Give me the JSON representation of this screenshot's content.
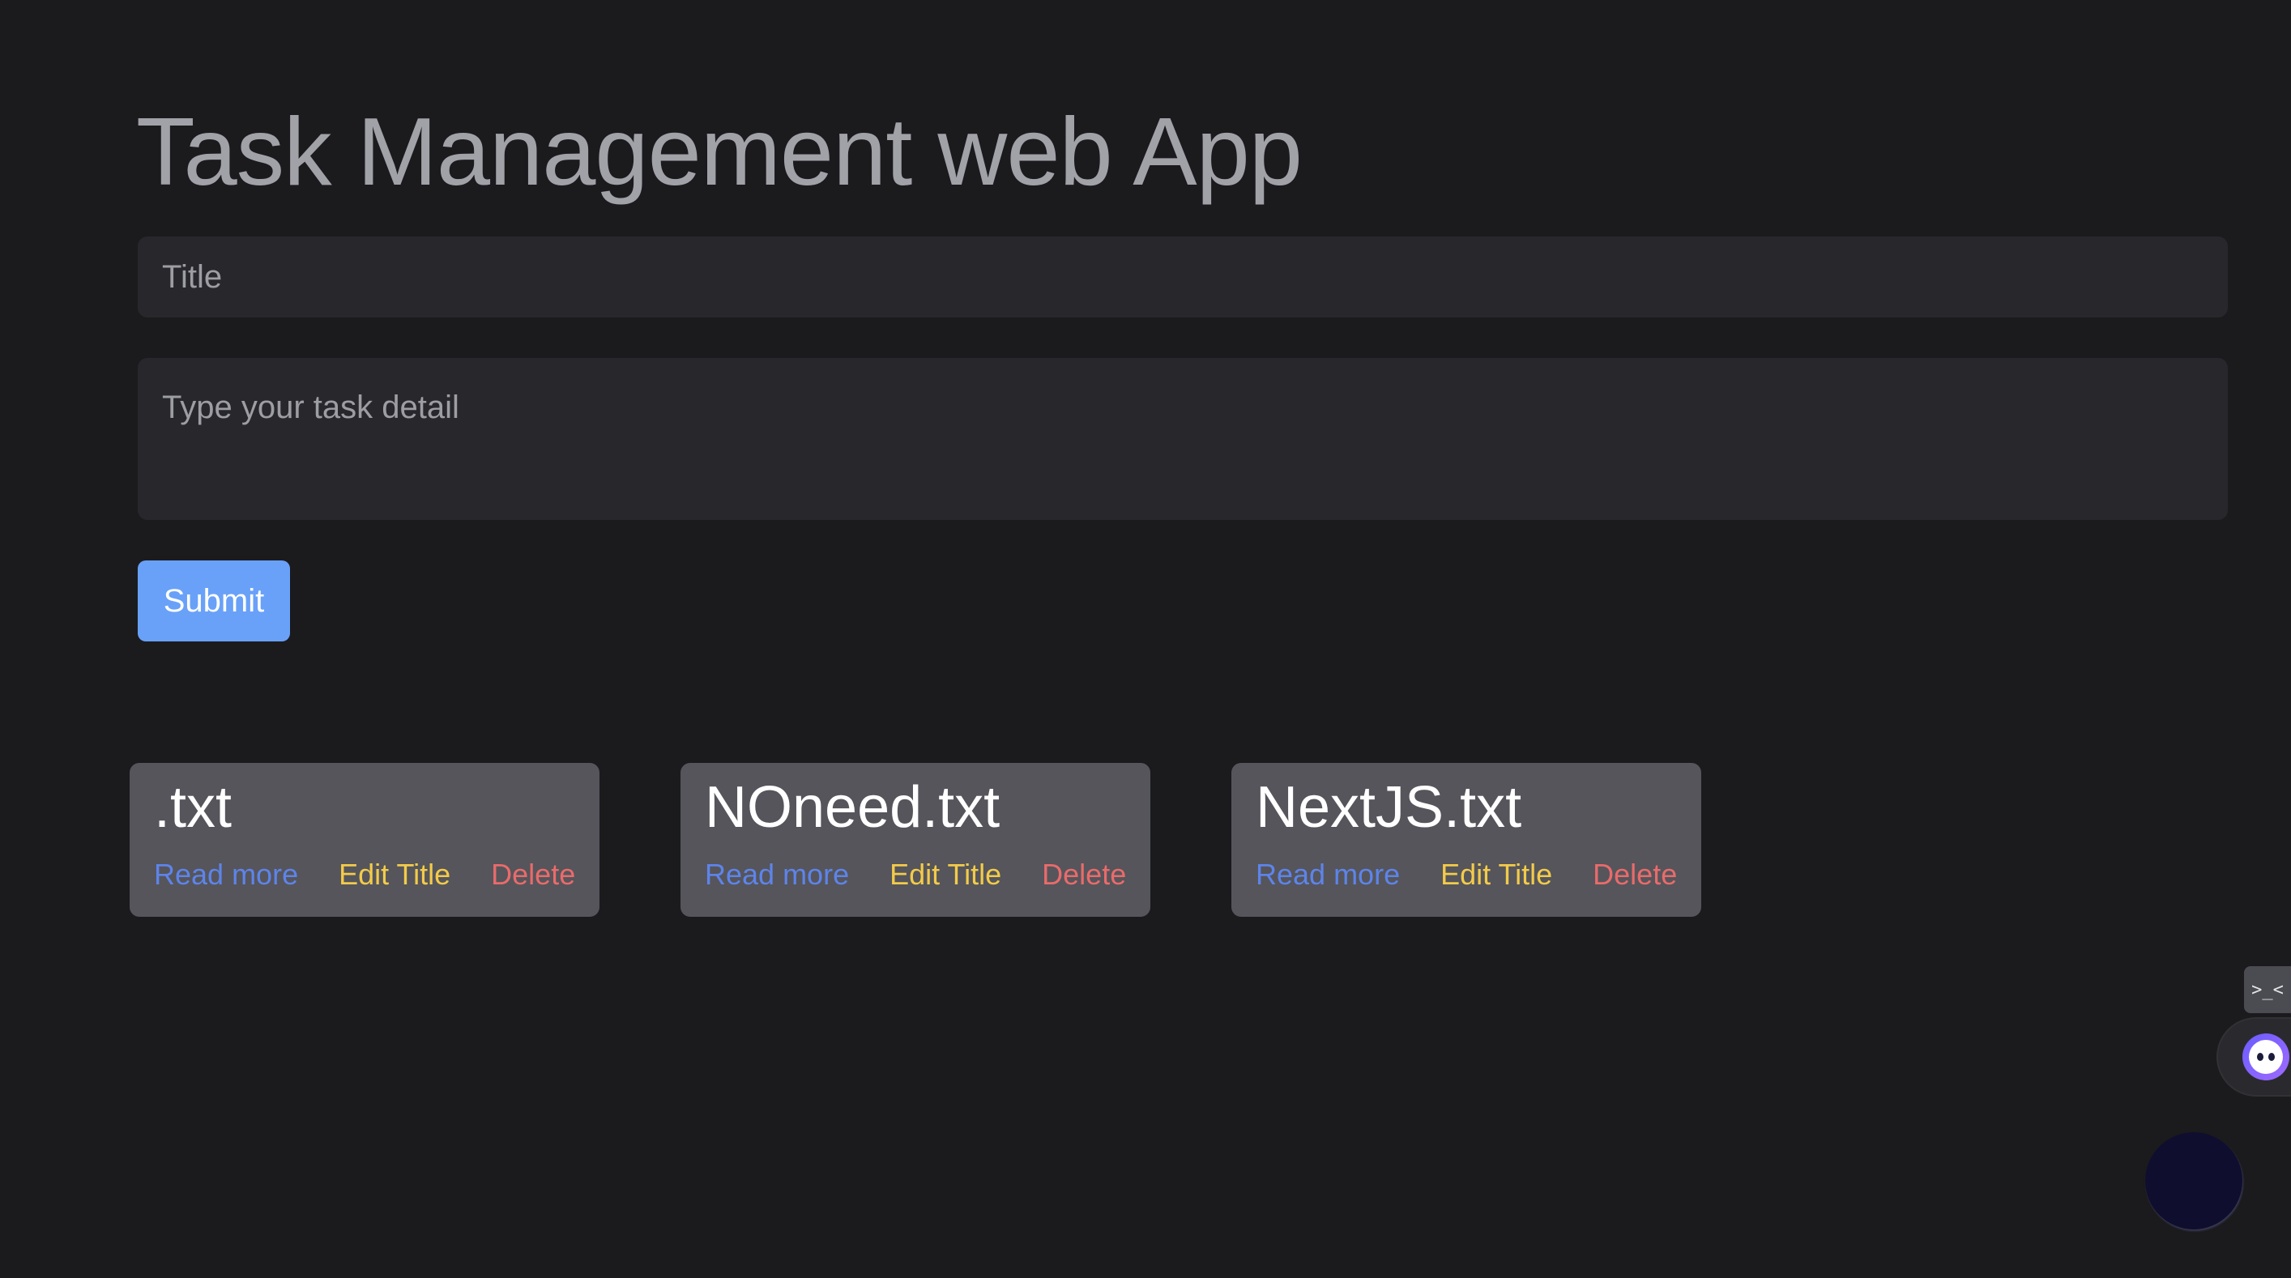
{
  "app": {
    "title": "Task Management web App"
  },
  "form": {
    "title_placeholder": "Title",
    "title_value": "",
    "detail_placeholder": "Type your task detail",
    "detail_value": "",
    "submit_label": "Submit"
  },
  "tasks": [
    {
      "title": ".txt",
      "read_more": "Read more",
      "edit_title": "Edit Title",
      "delete": "Delete"
    },
    {
      "title": "NOneed.txt",
      "read_more": "Read more",
      "edit_title": "Edit Title",
      "delete": "Delete"
    },
    {
      "title": "NextJS.txt",
      "read_more": "Read more",
      "edit_title": "Edit Title",
      "delete": "Delete"
    }
  ],
  "floating": {
    "extension_glyph": ">_<",
    "extension_icon": "terminal-icon",
    "mascot_icon": "mascot-face-icon",
    "circle_icon": "chat-bubble-icon"
  },
  "colors": {
    "background": "#1b1b1e",
    "title_text": "#a1a1a8",
    "field_bg": "#28282c",
    "submit_bg": "#69a1f8",
    "card_bg": "#55555b",
    "read_more": "#5e84ea",
    "edit_title": "#f3cb4a",
    "delete": "#e96b6b"
  }
}
